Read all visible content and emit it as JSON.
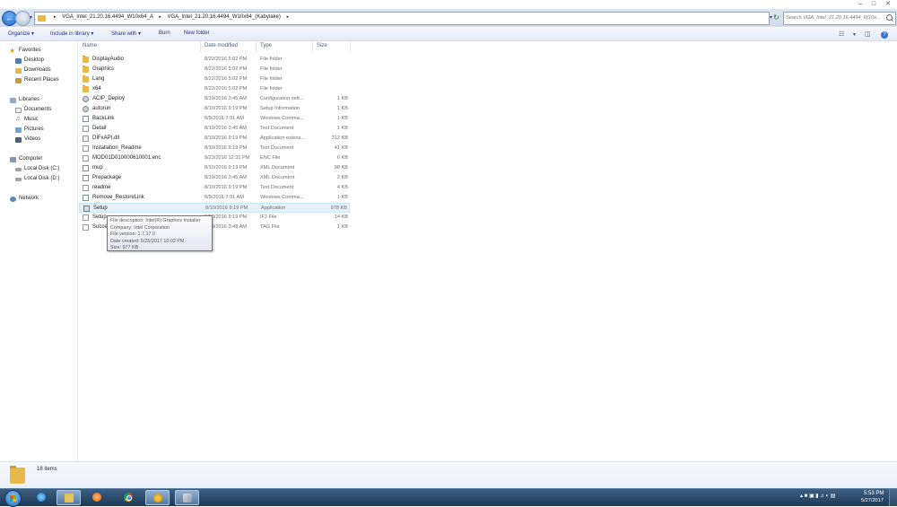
{
  "window": {
    "breadcrumbs": [
      "VGA_Intel_21.20.16.4494_W10x64_A",
      "VGA_Intel_21.20.16.4494_W10x64_(Kabylake)"
    ],
    "search_placeholder": "Search VGA_Intel_21.20.16.4494_W10x...",
    "controls": {
      "minimize": "–",
      "maximize": "□",
      "close": "✕"
    }
  },
  "toolbar": {
    "organize": "Organize ▾",
    "include_in_library": "Include in library ▾",
    "share_with": "Share with ▾",
    "burn": "Burn",
    "new_folder": "New folder",
    "help": "?"
  },
  "nav_pane": {
    "favorites": {
      "label": "Favorites",
      "items": [
        "Desktop",
        "Downloads",
        "Recent Places"
      ]
    },
    "libraries": {
      "label": "Libraries",
      "items": [
        "Documents",
        "Music",
        "Pictures",
        "Videos"
      ]
    },
    "computer": {
      "label": "Computer",
      "items": [
        "Local Disk (C:)",
        "Local Disk (D:)"
      ]
    },
    "network": {
      "label": "Network"
    }
  },
  "columns": {
    "name": "Name",
    "date_modified": "Date modified",
    "type": "Type",
    "size": "Size"
  },
  "files": [
    {
      "name": "DisplayAudio",
      "date": "8/22/2016 5:02 PM",
      "type": "File folder",
      "size": "",
      "icon": "folder-icon"
    },
    {
      "name": "Graphics",
      "date": "8/22/2016 5:02 PM",
      "type": "File folder",
      "size": "",
      "icon": "folder-icon"
    },
    {
      "name": "Lang",
      "date": "8/22/2016 5:02 PM",
      "type": "File folder",
      "size": "",
      "icon": "folder-icon"
    },
    {
      "name": "x64",
      "date": "8/22/2016 5:02 PM",
      "type": "File folder",
      "size": "",
      "icon": "folder-icon"
    },
    {
      "name": "ACIP_Deploy",
      "date": "8/19/2016 3:45 AM",
      "type": "Configuration sett...",
      "size": "1 KB",
      "icon": "config-file-icon"
    },
    {
      "name": "autorun",
      "date": "8/10/2016 9:19 PM",
      "type": "Setup Information",
      "size": "1 KB",
      "icon": "config-file-icon"
    },
    {
      "name": "BackLink",
      "date": "8/9/2016 7:31 AM",
      "type": "Windows Comma...",
      "size": "1 KB",
      "icon": "shortcut-icon"
    },
    {
      "name": "Detail",
      "date": "8/19/2016 3:45 AM",
      "type": "Text Document",
      "size": "1 KB",
      "icon": "text-file-icon"
    },
    {
      "name": "DIFxAPI.dll",
      "date": "8/10/2016 9:19 PM",
      "type": "Application extens...",
      "size": "312 KB",
      "icon": "dll-file-icon"
    },
    {
      "name": "Installation_Readme",
      "date": "8/10/2016 9:19 PM",
      "type": "Text Document",
      "size": "41 KB",
      "icon": "text-file-icon"
    },
    {
      "name": "MOD01D010000610001.enc",
      "date": "9/23/2016 12:31 PM",
      "type": "ENC File",
      "size": "6 KB",
      "icon": "generic-file-icon"
    },
    {
      "name": "mup",
      "date": "8/10/2016 9:19 PM",
      "type": "XML Document",
      "size": "98 KB",
      "icon": "xml-file-icon"
    },
    {
      "name": "Prepackage",
      "date": "8/19/2016 3:45 AM",
      "type": "XML Document",
      "size": "2 KB",
      "icon": "xml-file-icon"
    },
    {
      "name": "readme",
      "date": "8/10/2016 9:19 PM",
      "type": "Text Document",
      "size": "4 KB",
      "icon": "text-file-icon"
    },
    {
      "name": "Remove_RestoreLink",
      "date": "8/9/2016 7:31 AM",
      "type": "Windows Comma...",
      "size": "1 KB",
      "icon": "shortcut-icon"
    },
    {
      "name": "Setup",
      "date": "8/10/2016 9:19 PM",
      "type": "Application",
      "size": "978 KB",
      "icon": "application-icon",
      "selected": true
    },
    {
      "name": "Setup",
      "date": "8/10/2016 9:19 PM",
      "type": "IF2 File",
      "size": "14 KB",
      "icon": "generic-file-icon"
    },
    {
      "name": "Succe",
      "date": "8/19/2016 3:48 AM",
      "type": "TAG File",
      "size": "1 KB",
      "icon": "generic-file-icon"
    }
  ],
  "tooltip": {
    "description": "File description: Intel(R) Graphics Installer",
    "company": "Company: Intel Corporation",
    "version": "File version: 1.7.17.0",
    "created": "Date created: 5/25/2017 10:02 PM",
    "size": "Size: 977 KB"
  },
  "details_pane": {
    "item_count": "18 items"
  },
  "taskbar": {
    "apps": [
      "internet-explorer-icon",
      "windows-explorer-icon",
      "media-player-icon",
      "chrome-icon",
      "intel-installer-icon",
      "tool-icon"
    ],
    "tray": "▴  ■  ▣  ▮  ♫  ◐  ▤",
    "clock_time": "5:53 PM",
    "clock_date": "5/27/2017"
  }
}
